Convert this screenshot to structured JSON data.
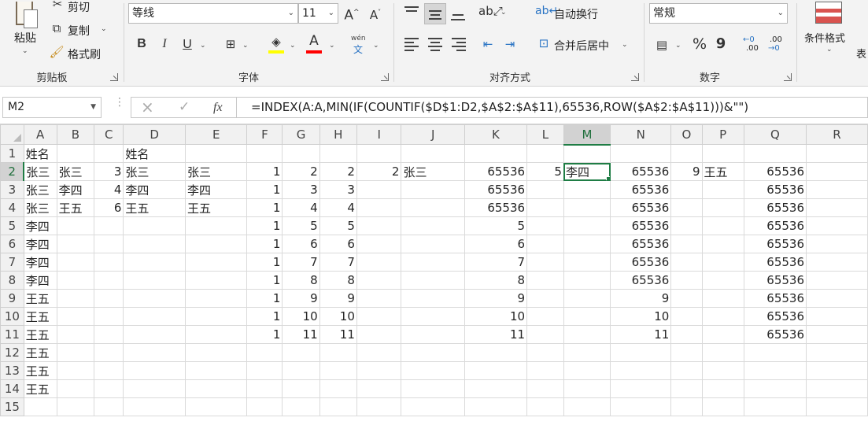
{
  "ribbon": {
    "clipboard": {
      "group_label": "剪贴板",
      "paste_label": "粘贴",
      "cut_label": "剪切",
      "copy_label": "复制",
      "format_painter_label": "格式刷"
    },
    "font": {
      "group_label": "字体",
      "font_name": "等线",
      "font_size": "11",
      "grow_label": "A",
      "shrink_label": "A",
      "bold_label": "B",
      "italic_label": "I",
      "underline_label": "U",
      "phonetic_top": "wén",
      "phonetic_bottom": "文",
      "font_color_label": "A"
    },
    "alignment": {
      "group_label": "对齐方式",
      "wrap_text_label": "自动换行",
      "merge_center_label": "合并后居中"
    },
    "number": {
      "group_label": "数字",
      "format_value": "常规",
      "percent_label": "%",
      "comma_label": "9",
      "inc_decimal_top": "←0",
      "inc_decimal_bottom": ".00",
      "dec_decimal_top": ".00",
      "dec_decimal_bottom": "→0"
    },
    "styles": {
      "conditional_format_label": "条件格式",
      "table_label": "表"
    },
    "colors": {
      "highlight": "#ffff00",
      "font_color": "#ff0000",
      "selection_green": "#1f7d45"
    }
  },
  "formula_bar": {
    "name_box": "M2",
    "cancel_icon": "×",
    "enter_icon": "✓",
    "fx_label": "fx",
    "formula": "=INDEX(A:A,MIN(IF(COUNTIF($D$1:D2,$A$2:$A$11),65536,ROW($A$2:$A$11)))&\"\")"
  },
  "sheet": {
    "columns": [
      "A",
      "B",
      "C",
      "D",
      "E",
      "F",
      "G",
      "H",
      "I",
      "J",
      "K",
      "L",
      "M",
      "N",
      "O",
      "P",
      "Q",
      "R"
    ],
    "selected_column": "M",
    "selected_row": 2,
    "active_cell": "M2",
    "rows": [
      {
        "n": "1",
        "A": "姓名",
        "D": "姓名"
      },
      {
        "n": "2",
        "A": "张三",
        "B": "张三",
        "C": "3",
        "D": "张三",
        "E": "张三",
        "F": "1",
        "G": "2",
        "H": "2",
        "I": "2",
        "J": "张三",
        "K": "65536",
        "L": "5",
        "M": "李四",
        "N": "65536",
        "O": "9",
        "P": "王五",
        "Q": "65536"
      },
      {
        "n": "3",
        "A": "张三",
        "B": "李四",
        "C": "4",
        "D": "李四",
        "E": "李四",
        "F": "1",
        "G": "3",
        "H": "3",
        "K": "65536",
        "N": "65536",
        "Q": "65536"
      },
      {
        "n": "4",
        "A": "张三",
        "B": "王五",
        "C": "6",
        "D": "王五",
        "E": "王五",
        "F": "1",
        "G": "4",
        "H": "4",
        "K": "65536",
        "N": "65536",
        "Q": "65536"
      },
      {
        "n": "5",
        "A": "李四",
        "F": "1",
        "G": "5",
        "H": "5",
        "K": "5",
        "N": "65536",
        "Q": "65536"
      },
      {
        "n": "6",
        "A": "李四",
        "F": "1",
        "G": "6",
        "H": "6",
        "K": "6",
        "N": "65536",
        "Q": "65536"
      },
      {
        "n": "7",
        "A": "李四",
        "F": "1",
        "G": "7",
        "H": "7",
        "K": "7",
        "N": "65536",
        "Q": "65536"
      },
      {
        "n": "8",
        "A": "李四",
        "F": "1",
        "G": "8",
        "H": "8",
        "K": "8",
        "N": "65536",
        "Q": "65536"
      },
      {
        "n": "9",
        "A": "王五",
        "F": "1",
        "G": "9",
        "H": "9",
        "K": "9",
        "N": "9",
        "Q": "65536"
      },
      {
        "n": "10",
        "A": "王五",
        "F": "1",
        "G": "10",
        "H": "10",
        "K": "10",
        "N": "10",
        "Q": "65536"
      },
      {
        "n": "11",
        "A": "王五",
        "F": "1",
        "G": "11",
        "H": "11",
        "K": "11",
        "N": "11",
        "Q": "65536"
      },
      {
        "n": "12",
        "A": "王五"
      },
      {
        "n": "13",
        "A": "王五"
      },
      {
        "n": "14",
        "A": "王五"
      },
      {
        "n": "15"
      }
    ]
  }
}
